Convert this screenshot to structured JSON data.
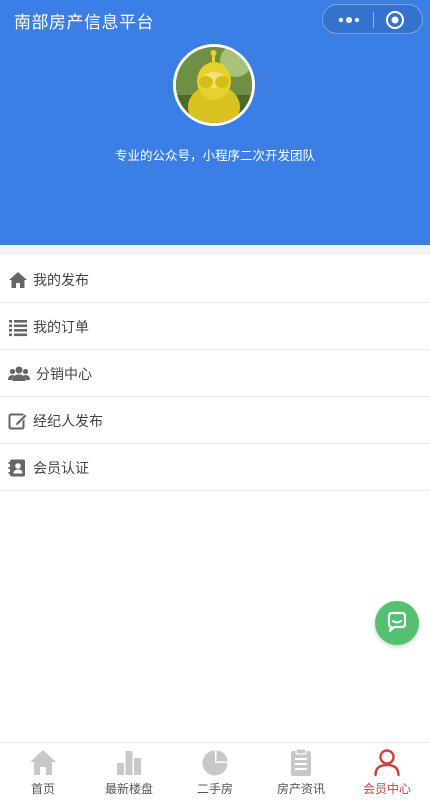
{
  "app": {
    "title": "南部房产信息平台"
  },
  "profile": {
    "slogan": "专业的公众号，小程序二次开发团队"
  },
  "menu": [
    {
      "label": "我的发布",
      "icon": "home-icon"
    },
    {
      "label": "我的订单",
      "icon": "list-icon"
    },
    {
      "label": "分销中心",
      "icon": "users-icon"
    },
    {
      "label": "经纪人发布",
      "icon": "edit-icon"
    },
    {
      "label": "会员认证",
      "icon": "id-card-icon"
    }
  ],
  "tabs": [
    {
      "label": "首页",
      "icon": "home-icon"
    },
    {
      "label": "最新楼盘",
      "icon": "bar-chart-icon"
    },
    {
      "label": "二手房",
      "icon": "pie-chart-icon"
    },
    {
      "label": "房产资讯",
      "icon": "clipboard-icon"
    },
    {
      "label": "会员中心",
      "icon": "user-icon",
      "active": true
    }
  ],
  "colors": {
    "header": "#3b7ee6",
    "active_tab": "#d0413c",
    "fab": "#54c170",
    "tab_icon": "#c8c8c8"
  }
}
